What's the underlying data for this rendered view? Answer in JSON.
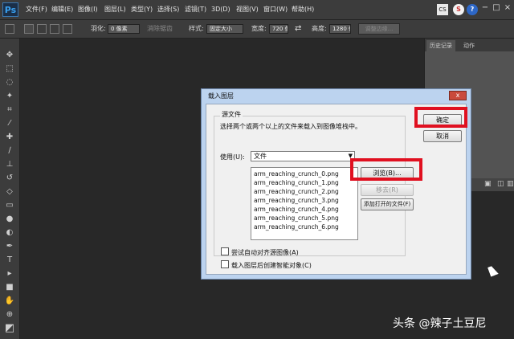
{
  "app": {
    "logo": "Ps",
    "menu": [
      "文件(F)",
      "编辑(E)",
      "图像(I)",
      "图层(L)",
      "类型(Y)",
      "选择(S)",
      "滤镜(T)",
      "3D(D)",
      "视图(V)",
      "窗口(W)",
      "帮助(H)"
    ],
    "cs_label": "CS",
    "window_controls": [
      "−",
      "□",
      "×"
    ]
  },
  "options_bar": {
    "feather_label": "羽化:",
    "feather_value": "0 像素",
    "antialias_label": "消除锯齿",
    "style_label": "样式:",
    "style_value": "固定大小",
    "width_label": "宽度:",
    "width_value": "720 像",
    "height_label": "高度:",
    "height_value": "1280 像",
    "refine_edge": "调整边缘..."
  },
  "right_panel": {
    "tabs": [
      "历史记录",
      "动作"
    ]
  },
  "dialog": {
    "title": "载入图层",
    "close": "x",
    "group_title": "源文件",
    "instruction": "选择两个或两个以上的文件来载入到图像堆栈中。",
    "use_label": "使用(U):",
    "use_value": "文件",
    "files": [
      "arm_reaching_crunch_0.png",
      "arm_reaching_crunch_1.png",
      "arm_reaching_crunch_2.png",
      "arm_reaching_crunch_3.png",
      "arm_reaching_crunch_4.png",
      "arm_reaching_crunch_5.png",
      "arm_reaching_crunch_6.png"
    ],
    "browse": "浏览(B)...",
    "remove": "移去(R)",
    "add_open": "添加打开的文件(F)",
    "ok": "确定",
    "cancel": "取消",
    "align_checkbox": "尝试自动对齐源图像(A)",
    "smart_object_checkbox": "载入图层后创建智能对象(C)"
  },
  "watermark": "头条 @辣子土豆尼",
  "colors": {
    "highlight": "#e01020",
    "ps_background": "#282828",
    "dialog_frame": "#bcd3ef"
  }
}
